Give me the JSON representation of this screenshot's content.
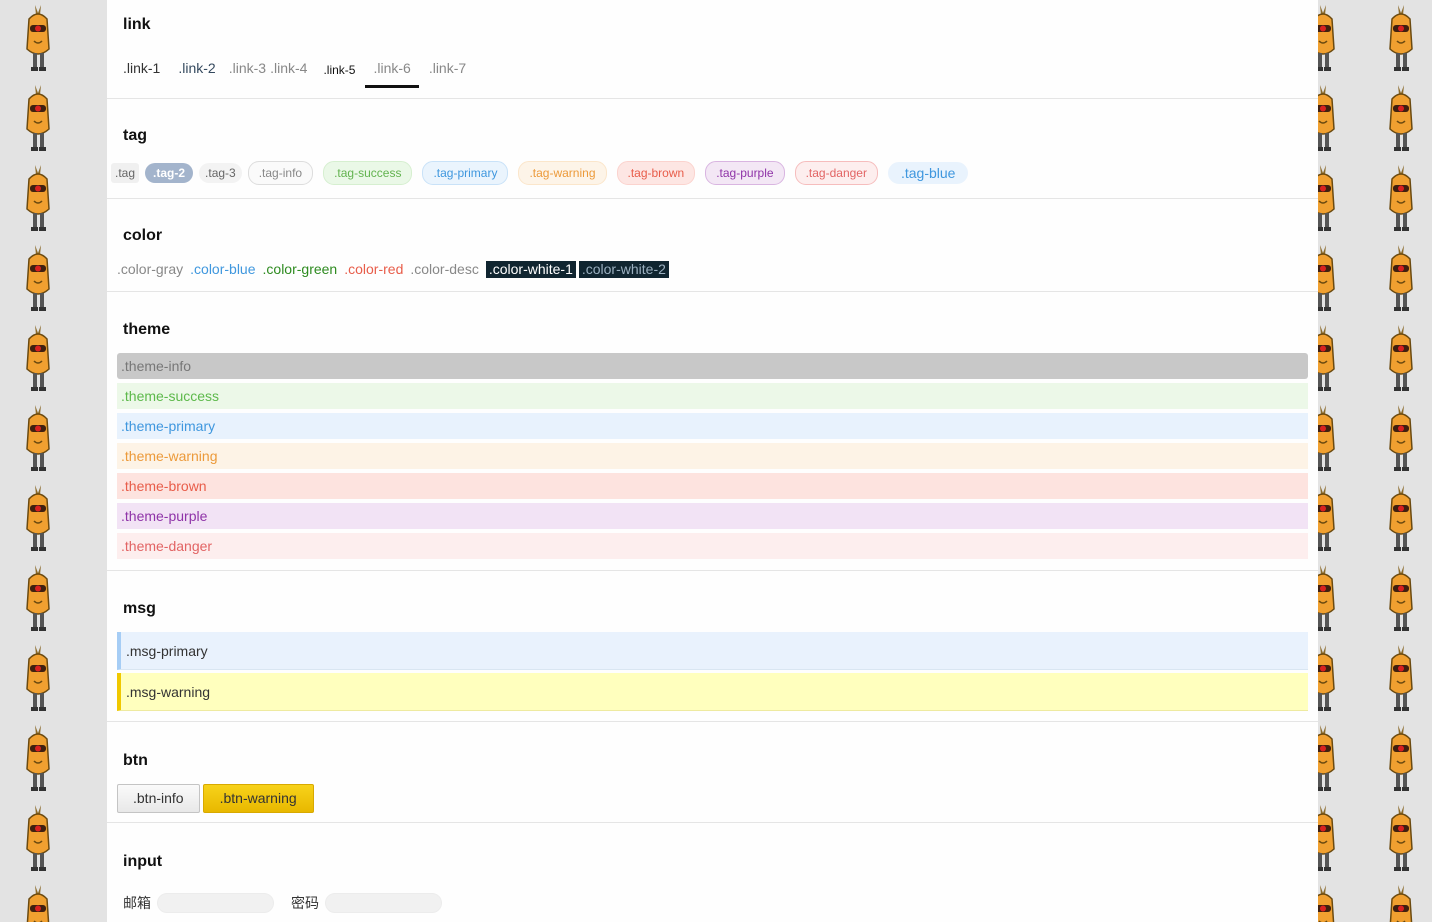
{
  "link": {
    "title": "link",
    "items": [
      ".link-1",
      ".link-2",
      ".link-3",
      ".link-4",
      ".link-5",
      ".link-6",
      ".link-7"
    ]
  },
  "tag": {
    "title": "tag",
    "items": [
      ".tag",
      ".tag-2",
      ".tag-3",
      ".tag-info",
      ".tag-success",
      ".tag-primary",
      ".tag-warning",
      ".tag-brown",
      ".tag-purple",
      ".tag-danger",
      ".tag-blue"
    ]
  },
  "color": {
    "title": "color",
    "items": [
      ".color-gray",
      ".color-blue",
      ".color-green",
      ".color-red",
      ".color-desc",
      ".color-white-1",
      ".color-white-2"
    ]
  },
  "theme": {
    "title": "theme",
    "items": [
      ".theme-info",
      ".theme-success",
      ".theme-primary",
      ".theme-warning",
      ".theme-brown",
      ".theme-purple",
      ".theme-danger"
    ]
  },
  "msg": {
    "title": "msg",
    "items": [
      ".msg-primary",
      ".msg-warning"
    ]
  },
  "btn": {
    "title": "btn",
    "items": [
      ".btn-info",
      ".btn-warning"
    ]
  },
  "input": {
    "title": "input",
    "email_label": "邮箱",
    "email_value": "",
    "password_label": "密码",
    "password_value": ""
  },
  "colors": {
    "page_background": "#e3e3e3",
    "mascot_orange": "#f0a030",
    "mascot_eye": "#d82020",
    "link_active_underline": "#111111",
    "msg_warning_bar": "#f0c800",
    "btn_warning": "#f0c800"
  }
}
